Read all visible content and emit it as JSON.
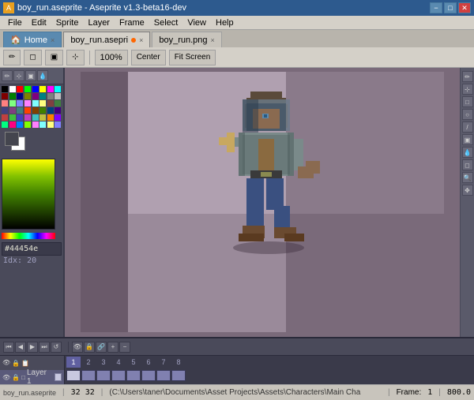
{
  "titleBar": {
    "title": "boy_run.aseprite - Aseprite v1.3-beta16-dev",
    "minLabel": "−",
    "maxLabel": "□",
    "closeLabel": "✕"
  },
  "menuBar": {
    "items": [
      "File",
      "Edit",
      "Sprite",
      "Layer",
      "Frame",
      "Select",
      "View",
      "Help"
    ]
  },
  "tabs": {
    "home": "🏠 Home",
    "tab1": "boy_run.asepri",
    "tab2": "boy_run.png",
    "tab1HasDot": true
  },
  "toolbar": {
    "zoomLevel": "100%",
    "centerLabel": "Center",
    "fitScreenLabel": "Fit Screen"
  },
  "palette": {
    "colors": [
      "#000000",
      "#ffffff",
      "#ff0000",
      "#00ff00",
      "#0000ff",
      "#ffff00",
      "#ff00ff",
      "#00ffff",
      "#800000",
      "#008000",
      "#000080",
      "#808000",
      "#800080",
      "#008080",
      "#808080",
      "#c0c0c0",
      "#ff8080",
      "#80ff80",
      "#8080ff",
      "#ff80ff",
      "#80ffff",
      "#ffff80",
      "#804040",
      "#408040",
      "#404080",
      "#804080",
      "#408080",
      "#ff4000",
      "#804000",
      "#408000",
      "#004080",
      "#400080",
      "#c04040",
      "#40c040",
      "#4040c0",
      "#c040c0",
      "#40c0c0",
      "#c0c040",
      "#ff8000",
      "#8000ff",
      "#00ff80",
      "#ff0080",
      "#0080ff",
      "#80ff00",
      "#ff80ff",
      "#80ffff",
      "#ffff80",
      "#8080ff"
    ],
    "selectedColor": "#44454e",
    "hexValue": "#44454e",
    "index": "Idx: 20"
  },
  "timeline": {
    "frameNumbers": [
      "1",
      "2",
      "3",
      "4",
      "5",
      "6",
      "7",
      "8"
    ],
    "layerName": "Layer 1",
    "playBtns": [
      "⏮",
      "◀",
      "▶",
      "⏭",
      "🔁"
    ],
    "controlBtns": [
      "👁",
      "🔒",
      "📋"
    ]
  },
  "statusBar": {
    "position": "32 32",
    "path": "(C:\\Users\\taner\\Documents\\Asset Projects\\Assets\\Characters\\Main Cha",
    "frameLabel": "Frame:",
    "frameValue": "1",
    "zoomValue": "800.0"
  },
  "rightTools": [
    "✏",
    "◻",
    "◯",
    "⟋",
    "🪣",
    "🔍",
    "💧",
    "✂",
    "🔧",
    "↕"
  ]
}
